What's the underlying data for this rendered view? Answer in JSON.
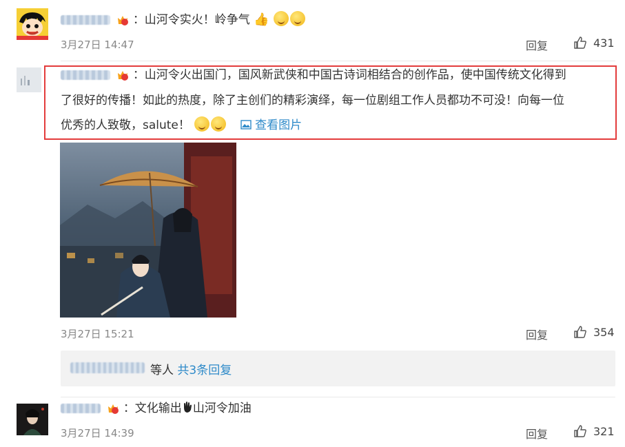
{
  "comments": [
    {
      "text": "：山河令实火！岭争气",
      "time": "3月27日 14:47",
      "reply": "回复",
      "likes": "431"
    },
    {
      "line1": "：山河令火出国门，国风新武侠和中国古诗词相结合的创作品，使中国传统文化得到",
      "line2": "了很好的传播！如此的热度，除了主创们的精彩演绎，每一位剧组工作人员都功不可没！向每一位",
      "line3": "优秀的人致敬，salute！",
      "view_pic": "查看图片",
      "time": "3月27日 15:21",
      "reply": "回复",
      "likes": "354",
      "sub_replies": {
        "suffix": "等人",
        "count": "共3条回复"
      }
    },
    {
      "text": "：文化输出",
      "text_after": "山河令加油",
      "time": "3月27日 14:39",
      "reply": "回复",
      "likes": "321"
    }
  ],
  "colors": {
    "link": "#2e8ac9",
    "highlight": "#e33b3b",
    "time": "#888888"
  },
  "icons": [
    "thumbs-up-icon",
    "vip-crown-icon",
    "picture-icon",
    "emoji-icon",
    "wave-hand-icon"
  ]
}
